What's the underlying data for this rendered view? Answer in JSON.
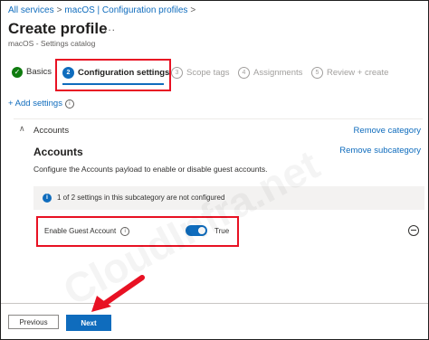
{
  "breadcrumb": {
    "items": [
      "All services",
      "macOS | Configuration profiles"
    ],
    "separator": ">"
  },
  "page": {
    "title": "Create profile",
    "more": "...",
    "subtitle": "macOS - Settings catalog"
  },
  "wizard": {
    "steps": [
      {
        "label": "Basics",
        "state": "complete"
      },
      {
        "number": "2",
        "label": "Configuration settings",
        "state": "active"
      },
      {
        "number": "3",
        "label": "Scope tags",
        "state": "pending"
      },
      {
        "number": "4",
        "label": "Assignments",
        "state": "pending"
      },
      {
        "number": "5",
        "label": "Review + create",
        "state": "pending"
      }
    ]
  },
  "add_settings": {
    "label": "+ Add settings"
  },
  "category": {
    "name": "Accounts",
    "remove_label": "Remove category"
  },
  "subcategory": {
    "title": "Accounts",
    "remove_label": "Remove subcategory",
    "description": "Configure the Accounts payload to enable or disable guest accounts.",
    "info_message": "1 of 2 settings in this subcategory are not configured"
  },
  "setting": {
    "label": "Enable Guest Account",
    "toggle_on": true,
    "value_label": "True"
  },
  "watermark": "CloudInfra.net",
  "footer": {
    "previous_label": "Previous",
    "next_label": "Next"
  },
  "colors": {
    "accent": "#0f6cbd",
    "highlight": "#e81123",
    "success": "#107c10"
  }
}
